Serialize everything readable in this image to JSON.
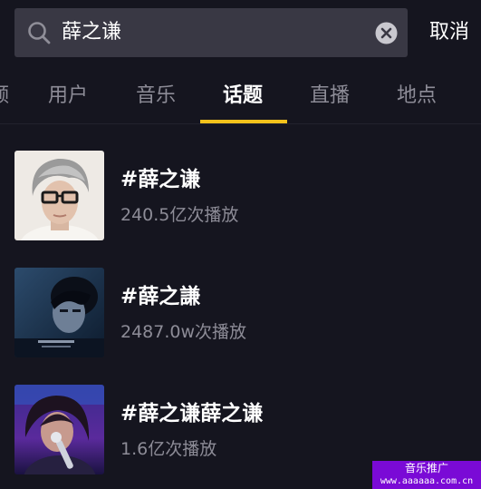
{
  "search": {
    "query": "薛之谦",
    "search_icon": "search-icon",
    "clear_icon": "clear-icon"
  },
  "header": {
    "cancel_label": "取消"
  },
  "tabs": [
    {
      "label": "频",
      "active": false
    },
    {
      "label": "用户",
      "active": false
    },
    {
      "label": "音乐",
      "active": false
    },
    {
      "label": "话题",
      "active": true
    },
    {
      "label": "直播",
      "active": false
    },
    {
      "label": "地点",
      "active": false
    }
  ],
  "results": [
    {
      "title": "#薛之谦",
      "plays": "240.5亿次播放"
    },
    {
      "title": "#薛之謙",
      "plays": "2487.0w次播放"
    },
    {
      "title": "#薛之谦薛之谦",
      "plays": "1.6亿次播放"
    }
  ],
  "watermark": {
    "title": "音乐推广",
    "url": "www.aaaaaa.com.cn"
  },
  "colors": {
    "background": "#15151f",
    "search_box": "#393844",
    "accent": "#f4c21b",
    "text_primary": "#ffffff",
    "text_secondary": "#8d8c97",
    "watermark_bg": "#7a0ad6"
  }
}
